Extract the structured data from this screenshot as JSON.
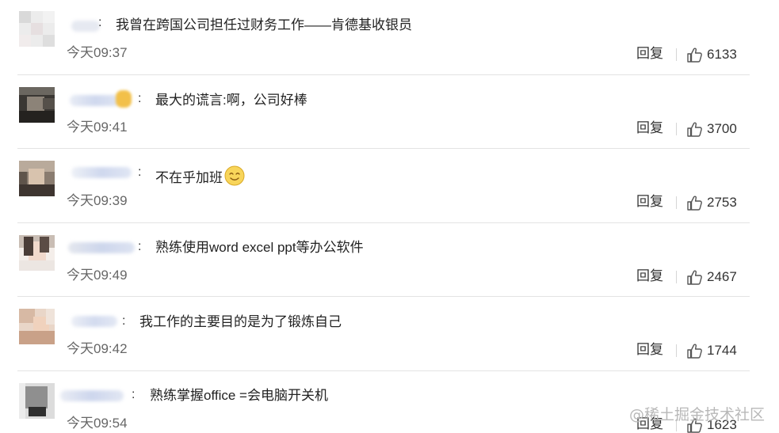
{
  "comments": [
    {
      "text": "我曾在跨国公司担任过财务工作——肯德基收银员",
      "time": "今天09:37",
      "reply": "回复",
      "likes": "6133",
      "has_emoji": false
    },
    {
      "text": "最大的谎言:啊，公司好棒",
      "time": "今天09:41",
      "reply": "回复",
      "likes": "3700",
      "has_emoji": false
    },
    {
      "text": "不在乎加班",
      "time": "今天09:39",
      "reply": "回复",
      "likes": "2753",
      "has_emoji": true
    },
    {
      "text": "熟练使用word excel ppt等办公软件",
      "time": "今天09:49",
      "reply": "回复",
      "likes": "2467",
      "has_emoji": false
    },
    {
      "text": "我工作的主要目的是为了锻炼自己",
      "time": "今天09:42",
      "reply": "回复",
      "likes": "1744",
      "has_emoji": false
    },
    {
      "text": "熟练掌握office =会电脑开关机",
      "time": "今天09:54",
      "reply": "回复",
      "likes": "1623",
      "has_emoji": false
    }
  ],
  "colon": ":",
  "watermark": "@稀土掘金技术社区",
  "colors": {
    "divider": "#e3e3e3",
    "text": "#222222",
    "muted": "#666666"
  }
}
